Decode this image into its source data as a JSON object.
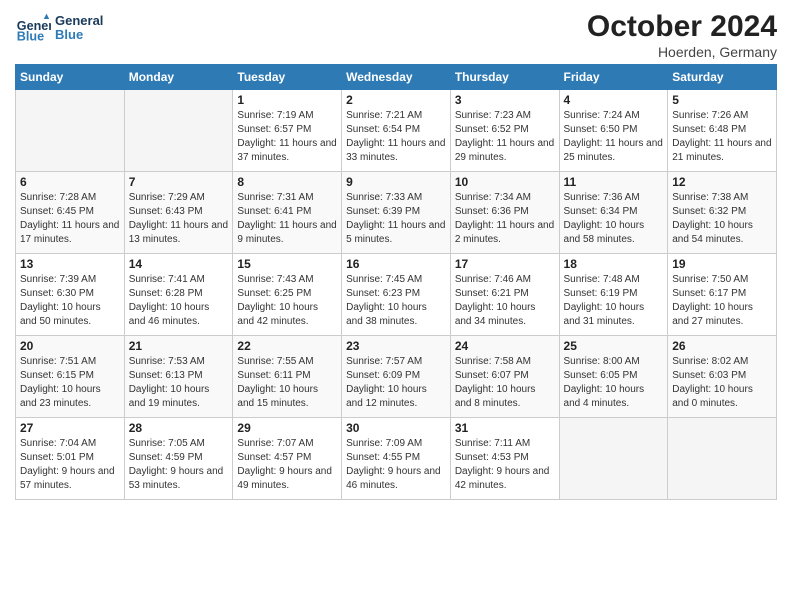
{
  "header": {
    "logo_general": "General",
    "logo_blue": "Blue",
    "month": "October 2024",
    "location": "Hoerden, Germany"
  },
  "weekdays": [
    "Sunday",
    "Monday",
    "Tuesday",
    "Wednesday",
    "Thursday",
    "Friday",
    "Saturday"
  ],
  "weeks": [
    [
      {
        "day": "",
        "empty": true
      },
      {
        "day": "",
        "empty": true
      },
      {
        "day": "1",
        "sunrise": "Sunrise: 7:19 AM",
        "sunset": "Sunset: 6:57 PM",
        "daylight": "Daylight: 11 hours and 37 minutes."
      },
      {
        "day": "2",
        "sunrise": "Sunrise: 7:21 AM",
        "sunset": "Sunset: 6:54 PM",
        "daylight": "Daylight: 11 hours and 33 minutes."
      },
      {
        "day": "3",
        "sunrise": "Sunrise: 7:23 AM",
        "sunset": "Sunset: 6:52 PM",
        "daylight": "Daylight: 11 hours and 29 minutes."
      },
      {
        "day": "4",
        "sunrise": "Sunrise: 7:24 AM",
        "sunset": "Sunset: 6:50 PM",
        "daylight": "Daylight: 11 hours and 25 minutes."
      },
      {
        "day": "5",
        "sunrise": "Sunrise: 7:26 AM",
        "sunset": "Sunset: 6:48 PM",
        "daylight": "Daylight: 11 hours and 21 minutes."
      }
    ],
    [
      {
        "day": "6",
        "sunrise": "Sunrise: 7:28 AM",
        "sunset": "Sunset: 6:45 PM",
        "daylight": "Daylight: 11 hours and 17 minutes."
      },
      {
        "day": "7",
        "sunrise": "Sunrise: 7:29 AM",
        "sunset": "Sunset: 6:43 PM",
        "daylight": "Daylight: 11 hours and 13 minutes."
      },
      {
        "day": "8",
        "sunrise": "Sunrise: 7:31 AM",
        "sunset": "Sunset: 6:41 PM",
        "daylight": "Daylight: 11 hours and 9 minutes."
      },
      {
        "day": "9",
        "sunrise": "Sunrise: 7:33 AM",
        "sunset": "Sunset: 6:39 PM",
        "daylight": "Daylight: 11 hours and 5 minutes."
      },
      {
        "day": "10",
        "sunrise": "Sunrise: 7:34 AM",
        "sunset": "Sunset: 6:36 PM",
        "daylight": "Daylight: 11 hours and 2 minutes."
      },
      {
        "day": "11",
        "sunrise": "Sunrise: 7:36 AM",
        "sunset": "Sunset: 6:34 PM",
        "daylight": "Daylight: 10 hours and 58 minutes."
      },
      {
        "day": "12",
        "sunrise": "Sunrise: 7:38 AM",
        "sunset": "Sunset: 6:32 PM",
        "daylight": "Daylight: 10 hours and 54 minutes."
      }
    ],
    [
      {
        "day": "13",
        "sunrise": "Sunrise: 7:39 AM",
        "sunset": "Sunset: 6:30 PM",
        "daylight": "Daylight: 10 hours and 50 minutes."
      },
      {
        "day": "14",
        "sunrise": "Sunrise: 7:41 AM",
        "sunset": "Sunset: 6:28 PM",
        "daylight": "Daylight: 10 hours and 46 minutes."
      },
      {
        "day": "15",
        "sunrise": "Sunrise: 7:43 AM",
        "sunset": "Sunset: 6:25 PM",
        "daylight": "Daylight: 10 hours and 42 minutes."
      },
      {
        "day": "16",
        "sunrise": "Sunrise: 7:45 AM",
        "sunset": "Sunset: 6:23 PM",
        "daylight": "Daylight: 10 hours and 38 minutes."
      },
      {
        "day": "17",
        "sunrise": "Sunrise: 7:46 AM",
        "sunset": "Sunset: 6:21 PM",
        "daylight": "Daylight: 10 hours and 34 minutes."
      },
      {
        "day": "18",
        "sunrise": "Sunrise: 7:48 AM",
        "sunset": "Sunset: 6:19 PM",
        "daylight": "Daylight: 10 hours and 31 minutes."
      },
      {
        "day": "19",
        "sunrise": "Sunrise: 7:50 AM",
        "sunset": "Sunset: 6:17 PM",
        "daylight": "Daylight: 10 hours and 27 minutes."
      }
    ],
    [
      {
        "day": "20",
        "sunrise": "Sunrise: 7:51 AM",
        "sunset": "Sunset: 6:15 PM",
        "daylight": "Daylight: 10 hours and 23 minutes."
      },
      {
        "day": "21",
        "sunrise": "Sunrise: 7:53 AM",
        "sunset": "Sunset: 6:13 PM",
        "daylight": "Daylight: 10 hours and 19 minutes."
      },
      {
        "day": "22",
        "sunrise": "Sunrise: 7:55 AM",
        "sunset": "Sunset: 6:11 PM",
        "daylight": "Daylight: 10 hours and 15 minutes."
      },
      {
        "day": "23",
        "sunrise": "Sunrise: 7:57 AM",
        "sunset": "Sunset: 6:09 PM",
        "daylight": "Daylight: 10 hours and 12 minutes."
      },
      {
        "day": "24",
        "sunrise": "Sunrise: 7:58 AM",
        "sunset": "Sunset: 6:07 PM",
        "daylight": "Daylight: 10 hours and 8 minutes."
      },
      {
        "day": "25",
        "sunrise": "Sunrise: 8:00 AM",
        "sunset": "Sunset: 6:05 PM",
        "daylight": "Daylight: 10 hours and 4 minutes."
      },
      {
        "day": "26",
        "sunrise": "Sunrise: 8:02 AM",
        "sunset": "Sunset: 6:03 PM",
        "daylight": "Daylight: 10 hours and 0 minutes."
      }
    ],
    [
      {
        "day": "27",
        "sunrise": "Sunrise: 7:04 AM",
        "sunset": "Sunset: 5:01 PM",
        "daylight": "Daylight: 9 hours and 57 minutes."
      },
      {
        "day": "28",
        "sunrise": "Sunrise: 7:05 AM",
        "sunset": "Sunset: 4:59 PM",
        "daylight": "Daylight: 9 hours and 53 minutes."
      },
      {
        "day": "29",
        "sunrise": "Sunrise: 7:07 AM",
        "sunset": "Sunset: 4:57 PM",
        "daylight": "Daylight: 9 hours and 49 minutes."
      },
      {
        "day": "30",
        "sunrise": "Sunrise: 7:09 AM",
        "sunset": "Sunset: 4:55 PM",
        "daylight": "Daylight: 9 hours and 46 minutes."
      },
      {
        "day": "31",
        "sunrise": "Sunrise: 7:11 AM",
        "sunset": "Sunset: 4:53 PM",
        "daylight": "Daylight: 9 hours and 42 minutes."
      },
      {
        "day": "",
        "empty": true
      },
      {
        "day": "",
        "empty": true
      }
    ]
  ]
}
